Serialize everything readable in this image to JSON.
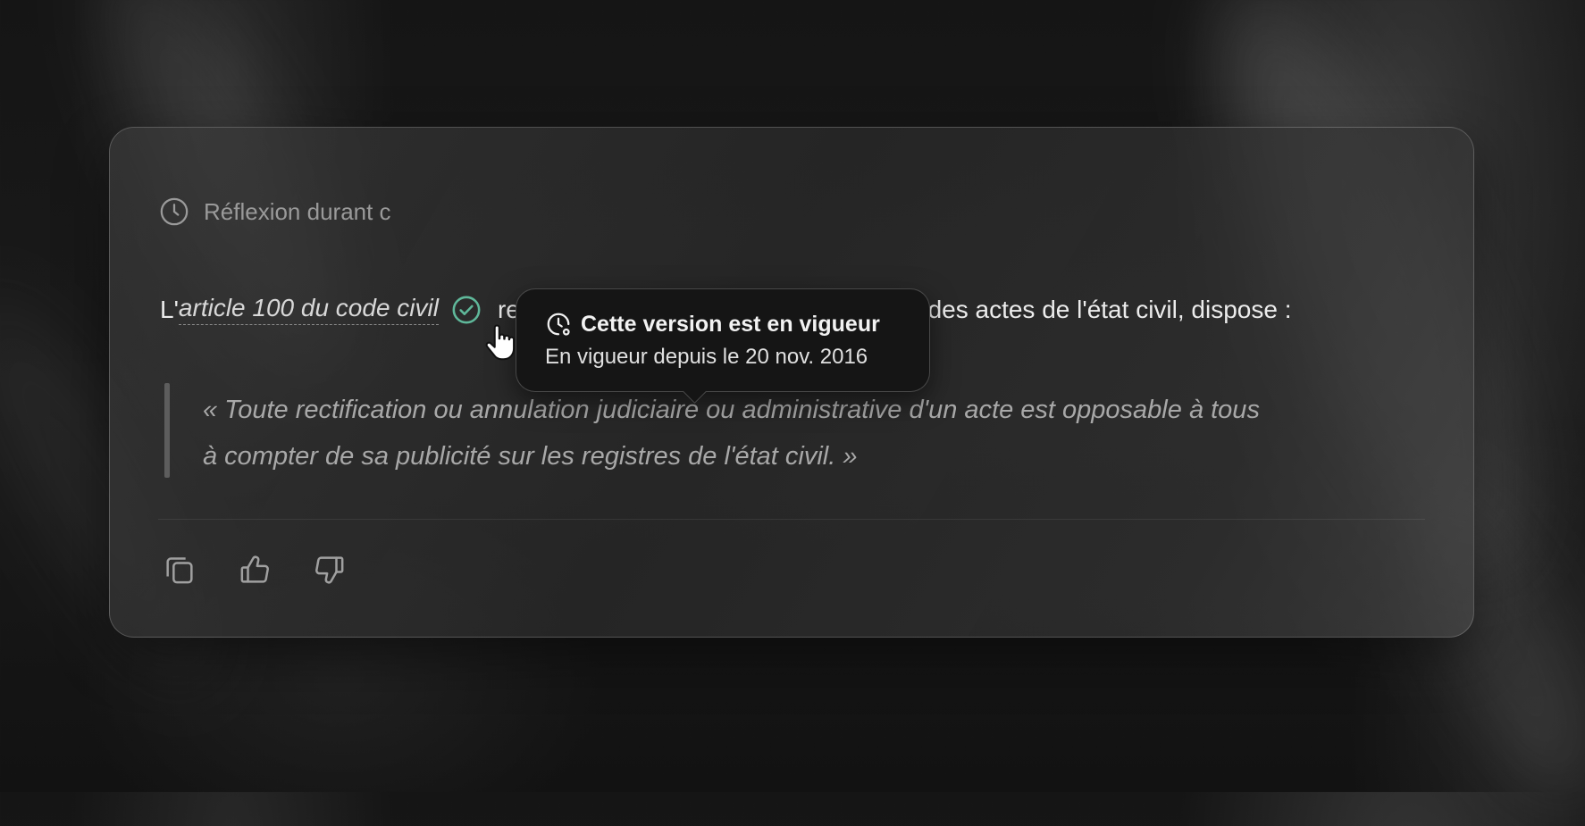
{
  "header": {
    "reflexion_label": "Réflexion durant c"
  },
  "message": {
    "prefix": "L'",
    "article_link": "article 100 du code civil",
    "suffix": "relatif à l'annulation et à la rectification des actes de l'état civil, dispose :",
    "quote_lines": [
      "« Toute rectification ou annulation judiciaire ou administrative d'un acte est opposable à tous",
      "à compter de sa publicité sur les registres de l'état civil. »"
    ]
  },
  "tooltip": {
    "title": "Cette version est en vigueur",
    "subtitle": "En vigueur depuis le 20 nov. 2016"
  },
  "actions": [
    {
      "name": "copy-icon"
    },
    {
      "name": "thumbs-up-icon"
    },
    {
      "name": "thumbs-down-icon"
    }
  ],
  "colors": {
    "check_accent": "#5fb89a",
    "card_border": "#4a4a4a",
    "text_primary": "#ececec",
    "text_muted": "#9a9a9a"
  }
}
